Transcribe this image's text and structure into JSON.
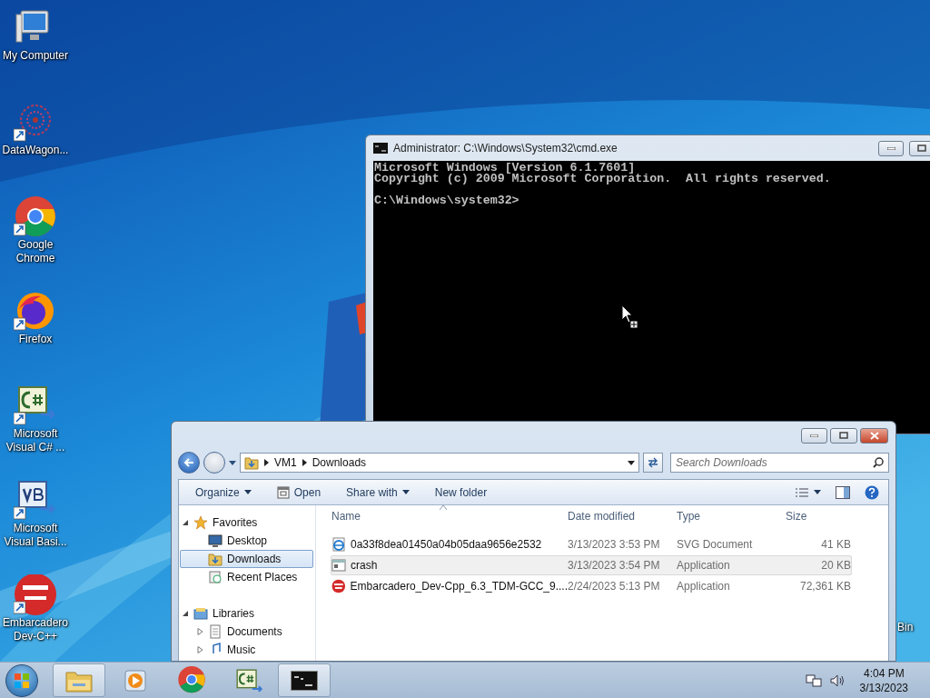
{
  "desktop_icons": [
    {
      "label": "My Computer",
      "kind": "computer",
      "shortcut": false
    },
    {
      "label": "DataWagon...",
      "kind": "network",
      "shortcut": true
    },
    {
      "label": "Google Chrome",
      "kind": "chrome",
      "shortcut": true
    },
    {
      "label": "Firefox",
      "kind": "firefox",
      "shortcut": true
    },
    {
      "label": "Microsoft Visual C# ...",
      "kind": "csharp",
      "shortcut": true
    },
    {
      "label": "Microsoft Visual Basi...",
      "kind": "vb",
      "shortcut": true
    },
    {
      "label": "Embarcadero Dev-C++",
      "kind": "devcpp",
      "shortcut": true
    }
  ],
  "recycle_bin_label": "Bin",
  "cmd_window": {
    "title": "Administrator: C:\\Windows\\System32\\cmd.exe",
    "output": [
      "Microsoft Windows [Version 6.1.7601]",
      "Copyright (c) 2009 Microsoft Corporation.  All rights reserved."
    ],
    "prompt": "C:\\Windows\\system32>"
  },
  "explorer": {
    "path": [
      "VM1",
      "Downloads"
    ],
    "search": {
      "placeholder": "Search Downloads"
    },
    "toolbar": [
      {
        "label": "Organize",
        "kind": "menu"
      },
      {
        "label": "Open",
        "kind": "open"
      },
      {
        "label": "Share with",
        "kind": "menu"
      },
      {
        "label": "New folder",
        "kind": "plain"
      }
    ],
    "nav": [
      {
        "label": "Favorites",
        "kind": "star",
        "expanded": true,
        "selected": false,
        "children": [
          {
            "label": "Desktop",
            "kind": "desktop",
            "selected": false
          },
          {
            "label": "Downloads",
            "kind": "downloads",
            "selected": true
          },
          {
            "label": "Recent Places",
            "kind": "recent",
            "selected": false
          }
        ]
      },
      {
        "label": "Libraries",
        "kind": "library",
        "expanded": true,
        "selected": false,
        "children": [
          {
            "label": "Documents",
            "kind": "documents",
            "selected": false,
            "expanded": false
          },
          {
            "label": "Music",
            "kind": "music",
            "selected": false,
            "expanded": false
          }
        ]
      }
    ],
    "columns": [
      "Name",
      "Date modified",
      "Type",
      "Size"
    ],
    "rows": [
      {
        "kind": "svg",
        "name": "0a33f8dea01450a04b05daa9656e2532",
        "date": "3/13/2023 3:53 PM",
        "type": "SVG Document",
        "size": "41 KB",
        "selected": false
      },
      {
        "kind": "app",
        "name": "crash",
        "date": "3/13/2023 3:54 PM",
        "type": "Application",
        "size": "20 KB",
        "selected": true
      },
      {
        "kind": "devcpp",
        "name": "Embarcadero_Dev-Cpp_6.3_TDM-GCC_9....",
        "date": "2/24/2023 5:13 PM",
        "type": "Application",
        "size": "72,361 KB",
        "selected": false
      }
    ]
  },
  "taskbar": {
    "apps": [
      {
        "kind": "explorer",
        "running": true
      },
      {
        "kind": "media",
        "running": false
      },
      {
        "kind": "chrome",
        "running": false
      },
      {
        "kind": "csharp",
        "running": false
      },
      {
        "kind": "cmd",
        "running": true
      }
    ],
    "clock": {
      "time": "4:04 PM",
      "date": "3/13/2023"
    }
  }
}
